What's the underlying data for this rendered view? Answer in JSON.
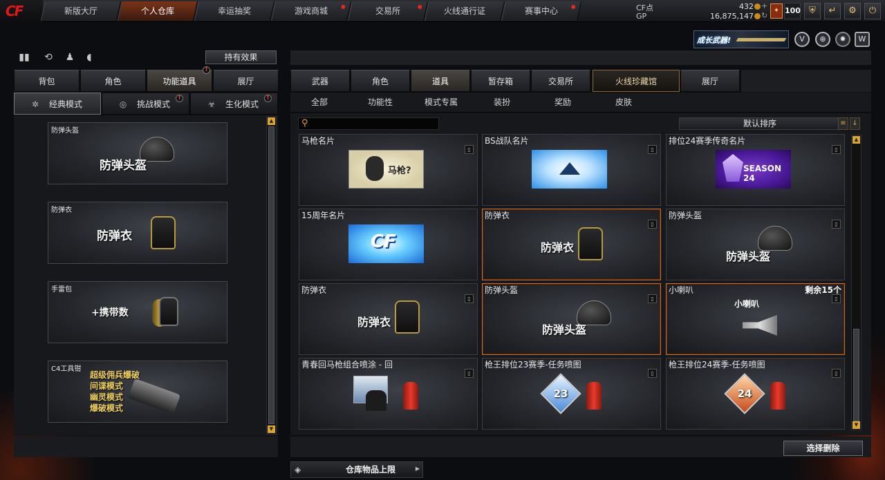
{
  "topnav": {
    "logo": "CF",
    "tabs": [
      {
        "label": "新版大厅"
      },
      {
        "label": "个人仓库"
      },
      {
        "label": "幸运抽奖"
      },
      {
        "label": "游戏商城"
      },
      {
        "label": "交易所"
      },
      {
        "label": "火线通行证"
      },
      {
        "label": "赛事中心"
      }
    ],
    "active_tab": "个人仓库"
  },
  "currency": {
    "cf_label": "CF点",
    "cf_value": "432",
    "gp_label": "GP",
    "gp_value": "16,875,147"
  },
  "level": {
    "value": "100"
  },
  "banner": {
    "text": "成长武器!"
  },
  "left": {
    "effect_button": "持有效果",
    "tabs": [
      {
        "label": "背包"
      },
      {
        "label": "角色"
      },
      {
        "label": "功能道具"
      },
      {
        "label": "展厅"
      }
    ],
    "modes": [
      {
        "label": "经典模式"
      },
      {
        "label": "挑战模式"
      },
      {
        "label": "生化模式"
      }
    ],
    "slots": [
      {
        "caption": "防弹头盔",
        "title": "防弹头盔"
      },
      {
        "caption": "防弹衣",
        "title": "防弹衣"
      },
      {
        "caption": "手雷包",
        "title": "+携带数"
      },
      {
        "caption": "C4工具钳",
        "lines": [
          "超级佣兵爆破",
          "间谍模式",
          "幽灵模式",
          "爆破模式"
        ]
      }
    ]
  },
  "right": {
    "tabs": [
      {
        "label": "武器"
      },
      {
        "label": "角色"
      },
      {
        "label": "道具"
      },
      {
        "label": "暂存箱"
      },
      {
        "label": "交易所"
      },
      {
        "label": "火线珍藏馆"
      },
      {
        "label": "展厅"
      }
    ],
    "subtabs": [
      {
        "label": "全部"
      },
      {
        "label": "功能性"
      },
      {
        "label": "模式专属"
      },
      {
        "label": "装扮"
      },
      {
        "label": "奖励"
      },
      {
        "label": "皮肤"
      }
    ],
    "sort_label": "默认排序",
    "items": [
      {
        "name": "马枪名片",
        "art_text": "马枪?"
      },
      {
        "name": "BS战队名片"
      },
      {
        "name": "排位24赛季传奇名片",
        "art_text": "SEASON 24"
      },
      {
        "name": "15周年名片",
        "art_text": "CF"
      },
      {
        "name": "防弹衣",
        "title": "防弹衣"
      },
      {
        "name": "防弹头盔",
        "title": "防弹头盔"
      },
      {
        "name": "防弹衣",
        "title": "防弹衣"
      },
      {
        "name": "防弹头盔",
        "title": "防弹头盔"
      },
      {
        "name": "小喇叭",
        "title": "小喇叭",
        "remain": "剩余15个"
      },
      {
        "name": "青春回马枪组合喷涂 - 回"
      },
      {
        "name": "枪王排位23赛季-任务喷图",
        "rank": "23"
      },
      {
        "name": "枪王排位24赛季-任务喷图",
        "rank": "24"
      }
    ],
    "select_delete": "选择删除",
    "capacity_label": "仓库物品上限"
  },
  "colors": {
    "accent": "#d8a530",
    "active_tab": "#7a3418",
    "selected_border": "#c86a2a"
  },
  "icons": [
    "stats-icon",
    "history-icon",
    "character-icon",
    "mouse-icon",
    "search-icon",
    "trash-icon",
    "list-view-icon",
    "sort-down-icon",
    "settings-icon",
    "power-icon",
    "back-icon",
    "shield-icon"
  ]
}
